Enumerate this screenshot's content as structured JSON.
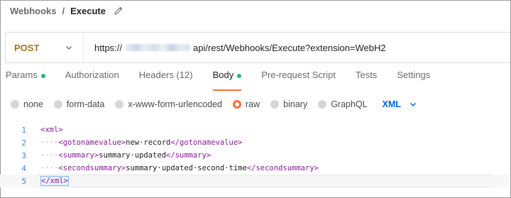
{
  "breadcrumb": {
    "parent": "Webhooks",
    "separator": "/",
    "current": "Execute"
  },
  "request": {
    "method": "POST",
    "url_prefix": "https://",
    "url_suffix": "api/rest/Webhooks/Execute?extension=WebH2"
  },
  "tabs": [
    {
      "label": "Params",
      "dot": true
    },
    {
      "label": "Authorization"
    },
    {
      "label": "Headers (12)"
    },
    {
      "label": "Body",
      "dot": true,
      "active": true
    },
    {
      "label": "Pre-request Script"
    },
    {
      "label": "Tests"
    },
    {
      "label": "Settings"
    }
  ],
  "body_modes": {
    "options": [
      "none",
      "form-data",
      "x-www-form-urlencoded",
      "raw",
      "binary",
      "GraphQL"
    ],
    "selected": "raw",
    "language": "XML"
  },
  "editor": {
    "line_numbers": [
      "1",
      "2",
      "3",
      "4",
      "5"
    ],
    "lines": [
      {
        "indent": "",
        "open": "<xml>",
        "text": "",
        "close": ""
      },
      {
        "indent": "····",
        "open": "<gotonamevalue>",
        "text": "new·record",
        "close": "</gotonamevalue>"
      },
      {
        "indent": "····",
        "open": "<summary>",
        "text": "summary·updated",
        "close": "</summary>"
      },
      {
        "indent": "····",
        "open": "<secondsummary>",
        "text": "summary·updated·second·time",
        "close": "</secondsummary>"
      },
      {
        "indent": "",
        "open": "</xml>",
        "text": "",
        "close": ""
      }
    ]
  },
  "colors": {
    "accent": "#ff6c37",
    "method": "#a8741a",
    "success_dot": "#26b47f",
    "link": "#0265d2",
    "xml_tag": "#8a1a9a"
  }
}
